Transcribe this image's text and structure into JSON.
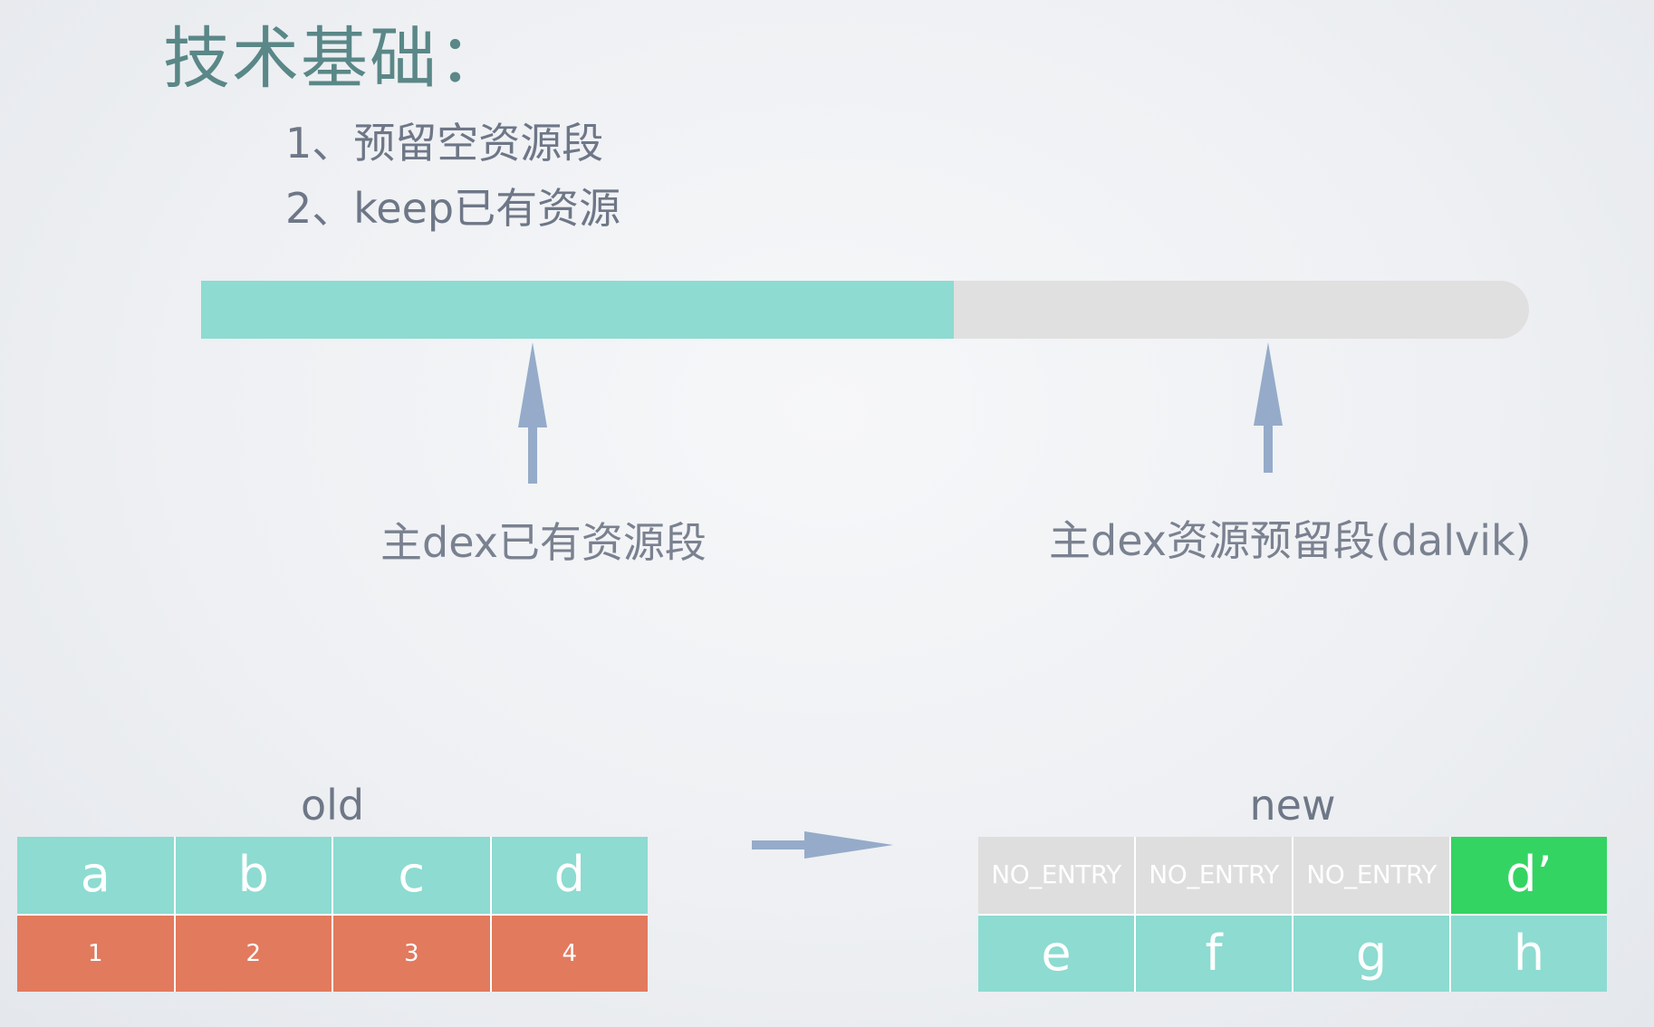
{
  "title": "技术基础：",
  "bullets": [
    "1、预留空资源段",
    "2、keep已有资源"
  ],
  "progress": {
    "filled_fraction": 0.567,
    "filled_color": "#8ddbd1",
    "empty_color": "#e0e0e0"
  },
  "captions": {
    "left": "主dex已有资源段",
    "right": "主dex资源预留段(dalvik)"
  },
  "old_table": {
    "label": "old",
    "row1": [
      "a",
      "b",
      "c",
      "d"
    ],
    "row2": [
      "1",
      "2",
      "3",
      "4"
    ]
  },
  "new_table": {
    "label": "new",
    "row1": [
      "NO_ENTRY",
      "NO_ENTRY",
      "NO_ENTRY",
      "d’"
    ],
    "row2": [
      "e",
      "f",
      "g",
      "h"
    ]
  },
  "colors": {
    "teal": "#8ddbd1",
    "red": "#e27a5e",
    "gray": "#dedede",
    "green": "#34d463",
    "arrow": "#95abc9"
  }
}
